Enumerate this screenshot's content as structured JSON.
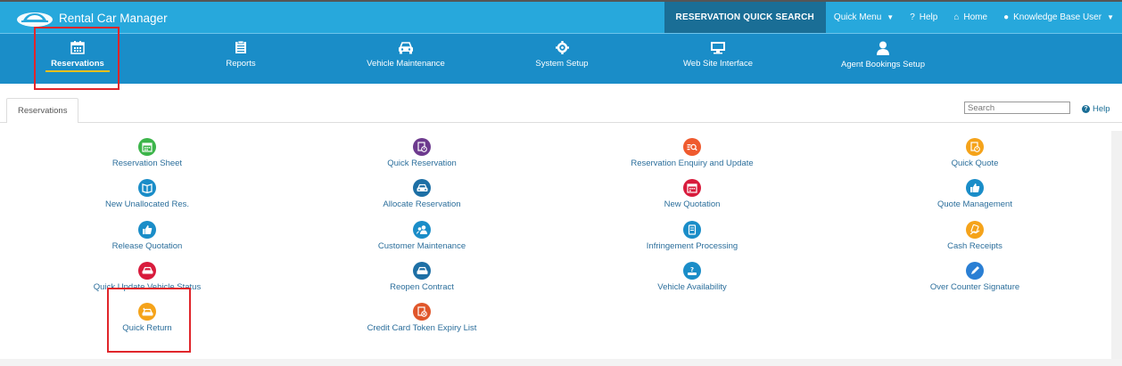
{
  "app": {
    "title": "Rental Car Manager"
  },
  "topnav": {
    "quick_search": "RESERVATION QUICK SEARCH",
    "quick_menu": "Quick Menu",
    "help": "Help",
    "home": "Home",
    "user": "Knowledge Base User"
  },
  "modules": [
    {
      "label": "Reservations",
      "icon": "calendar-icon"
    },
    {
      "label": "Reports",
      "icon": "report-icon"
    },
    {
      "label": "Vehicle Maintenance",
      "icon": "car-icon"
    },
    {
      "label": "System Setup",
      "icon": "gear-icon"
    },
    {
      "label": "Web Site Interface",
      "icon": "monitor-icon"
    },
    {
      "label": "Agent Bookings Setup",
      "icon": "agent-icon"
    }
  ],
  "tab": {
    "label": "Reservations"
  },
  "search": {
    "placeholder": "Search"
  },
  "help_link": "Help",
  "items": {
    "reservation_sheet": "Reservation Sheet",
    "quick_reservation": "Quick Reservation",
    "reservation_enquiry": "Reservation Enquiry and Update",
    "quick_quote": "Quick Quote",
    "new_unallocated": "New Unallocated Res.",
    "allocate_reservation": "Allocate Reservation",
    "new_quotation": "New Quotation",
    "quote_management": "Quote Management",
    "release_quotation": "Release Quotation",
    "customer_maintenance": "Customer Maintenance",
    "infringement_processing": "Infringement Processing",
    "cash_receipts": "Cash Receipts",
    "quick_update_status": "Quick Update Vehicle Status",
    "reopen_contract": "Reopen Contract",
    "vehicle_availability": "Vehicle Availability",
    "over_counter_signature": "Over Counter Signature",
    "quick_return": "Quick Return",
    "cc_token_expiry": "Credit Card Token Expiry List"
  },
  "colors": {
    "topbar": "#27a8dc",
    "modulebar": "#1a8dc8",
    "highlight": "#e0262b",
    "link": "#2b6e9b"
  }
}
